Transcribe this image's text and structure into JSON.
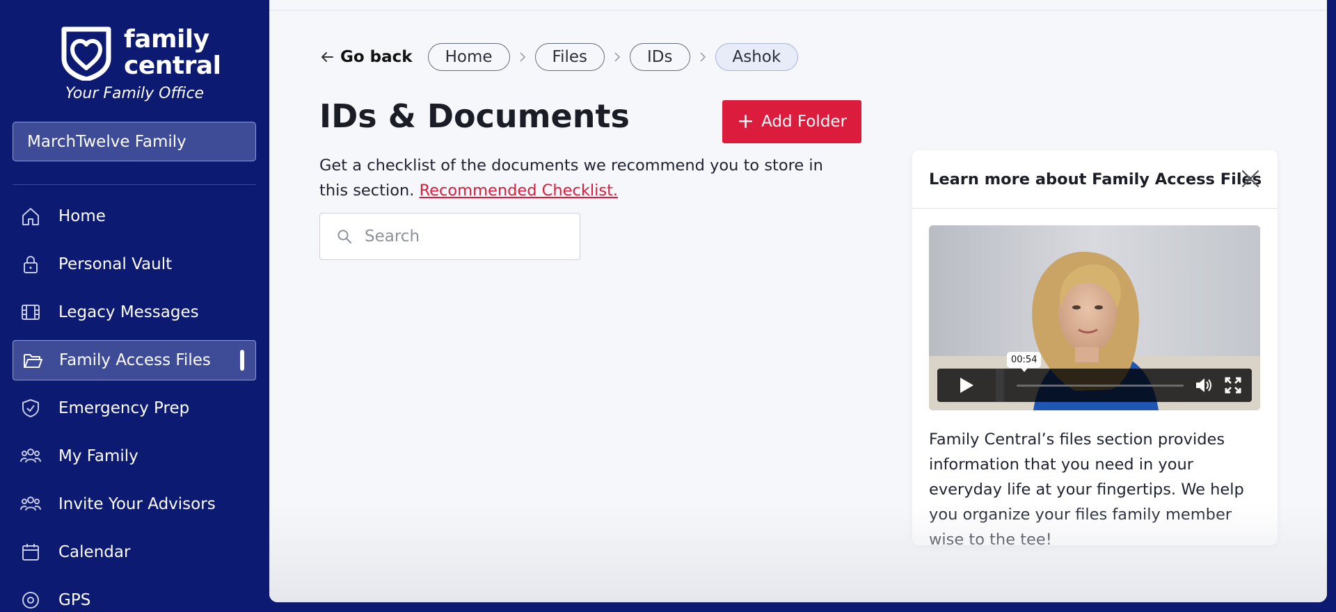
{
  "brand": {
    "name_line1": "family",
    "name_line2": "central",
    "tagline": "Your Family Office"
  },
  "sidebar": {
    "family_selector": "MarchTwelve Family",
    "items": [
      {
        "label": "Home",
        "icon": "home-icon"
      },
      {
        "label": "Personal Vault",
        "icon": "lock-icon"
      },
      {
        "label": "Legacy Messages",
        "icon": "film-icon"
      },
      {
        "label": "Family Access Files",
        "icon": "folder-open-icon",
        "active": true
      },
      {
        "label": "Emergency Prep",
        "icon": "shield-check-icon"
      },
      {
        "label": "My Family",
        "icon": "people-icon"
      },
      {
        "label": "Invite Your Advisors",
        "icon": "people-icon"
      },
      {
        "label": "Calendar",
        "icon": "calendar-icon"
      },
      {
        "label": "GPS",
        "icon": "location-icon"
      }
    ]
  },
  "breadcrumb": {
    "go_back": "Go back",
    "items": [
      "Home",
      "Files",
      "IDs",
      "Ashok"
    ]
  },
  "page": {
    "title": "IDs & Documents",
    "add_folder": "Add Folder",
    "description": "Get a checklist of the documents we recommend you to store in this section.",
    "checklist_link": "Recommended Checklist.",
    "search_placeholder": "Search"
  },
  "learn_card": {
    "title": "Learn more about Family Access Files",
    "video_time": "00:54",
    "body": "Family Central’s files section provides information that you need in your everyday life at your fingertips. We help you organize your files family member wise to the tee!"
  },
  "colors": {
    "sidebar_bg": "#0c1a72",
    "accent_red": "#dc1c3d",
    "main_bg": "#f6f7fa"
  }
}
